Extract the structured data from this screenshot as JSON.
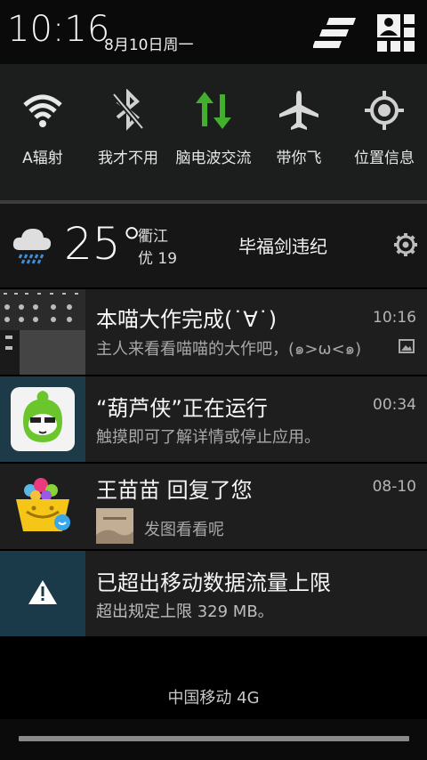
{
  "status": {
    "time": "10:16",
    "date": "8月10日周一"
  },
  "toggles": [
    {
      "label": "A辐射",
      "icon": "wifi-icon",
      "state": "on"
    },
    {
      "label": "我才不用",
      "icon": "bluetooth-icon",
      "state": "off"
    },
    {
      "label": "脑电波交流",
      "icon": "sync-icon",
      "state": "on",
      "accent": "#42b02c"
    },
    {
      "label": "带你飞",
      "icon": "airplane-icon",
      "state": "off"
    },
    {
      "label": "位置信息",
      "icon": "location-icon",
      "state": "off"
    }
  ],
  "weather": {
    "temperature": "25°",
    "city": "衢江",
    "aqi": "优 19",
    "text": "毕福剑违纪",
    "icon": "cloud-rain-icon"
  },
  "notifications": [
    {
      "title": "本喵大作完成(˙∀˙)",
      "subtitle": "主人来看看喵喵的大作吧，(๑>ω<๑)",
      "time": "10:16",
      "icon": "screenshot-thumbnail"
    },
    {
      "title": "“葫芦侠”正在运行",
      "subtitle": "触摸即可了解详情或停止应用。",
      "time": "00:34",
      "icon": "huluxia-app-icon"
    },
    {
      "title": "王苗苗 回复了您",
      "subtitle": "发图看看呢",
      "time": "08-10",
      "icon": "gift-basket-app-icon"
    },
    {
      "title": "已超出移动数据流量上限",
      "subtitle": "超出规定上限 329 MB。",
      "time": "",
      "icon": "warning-icon"
    }
  ],
  "carrier": "中国移动 4G",
  "colors": {
    "accent_green": "#42b02c",
    "panel": "#1c1e1d",
    "warning_bg": "#1b3a49"
  }
}
